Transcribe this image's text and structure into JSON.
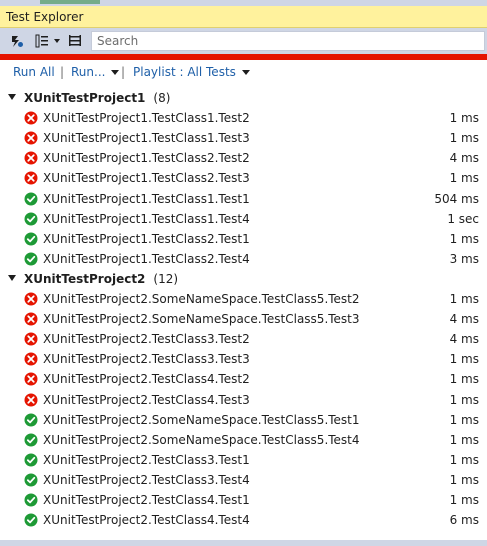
{
  "window": {
    "title": "Test Explorer"
  },
  "search": {
    "placeholder": "Search"
  },
  "actions": {
    "run_all": "Run All",
    "run": "Run...",
    "playlist": "Playlist : All Tests"
  },
  "colors": {
    "fail": "#e51400",
    "pass": "#1e9a36",
    "link": "#1e5fa8",
    "title_bg": "#fff29d"
  },
  "groups": [
    {
      "name": "XUnitTestProject1",
      "count": "(8)",
      "tests": [
        {
          "status": "fail",
          "name": "XUnitTestProject1.TestClass1.Test2",
          "duration": "1 ms"
        },
        {
          "status": "fail",
          "name": "XUnitTestProject1.TestClass1.Test3",
          "duration": "1 ms"
        },
        {
          "status": "fail",
          "name": "XUnitTestProject1.TestClass2.Test2",
          "duration": "4 ms"
        },
        {
          "status": "fail",
          "name": "XUnitTestProject1.TestClass2.Test3",
          "duration": "1 ms"
        },
        {
          "status": "pass",
          "name": "XUnitTestProject1.TestClass1.Test1",
          "duration": "504 ms"
        },
        {
          "status": "pass",
          "name": "XUnitTestProject1.TestClass1.Test4",
          "duration": "1 sec"
        },
        {
          "status": "pass",
          "name": "XUnitTestProject1.TestClass2.Test1",
          "duration": "1 ms"
        },
        {
          "status": "pass",
          "name": "XUnitTestProject1.TestClass2.Test4",
          "duration": "3 ms"
        }
      ]
    },
    {
      "name": "XUnitTestProject2",
      "count": "(12)",
      "tests": [
        {
          "status": "fail",
          "name": "XUnitTestProject2.SomeNameSpace.TestClass5.Test2",
          "duration": "1 ms"
        },
        {
          "status": "fail",
          "name": "XUnitTestProject2.SomeNameSpace.TestClass5.Test3",
          "duration": "4 ms"
        },
        {
          "status": "fail",
          "name": "XUnitTestProject2.TestClass3.Test2",
          "duration": "4 ms"
        },
        {
          "status": "fail",
          "name": "XUnitTestProject2.TestClass3.Test3",
          "duration": "1 ms"
        },
        {
          "status": "fail",
          "name": "XUnitTestProject2.TestClass4.Test2",
          "duration": "1 ms"
        },
        {
          "status": "fail",
          "name": "XUnitTestProject2.TestClass4.Test3",
          "duration": "1 ms"
        },
        {
          "status": "pass",
          "name": "XUnitTestProject2.SomeNameSpace.TestClass5.Test1",
          "duration": "1 ms"
        },
        {
          "status": "pass",
          "name": "XUnitTestProject2.SomeNameSpace.TestClass5.Test4",
          "duration": "1 ms"
        },
        {
          "status": "pass",
          "name": "XUnitTestProject2.TestClass3.Test1",
          "duration": "1 ms"
        },
        {
          "status": "pass",
          "name": "XUnitTestProject2.TestClass3.Test4",
          "duration": "1 ms"
        },
        {
          "status": "pass",
          "name": "XUnitTestProject2.TestClass4.Test1",
          "duration": "1 ms"
        },
        {
          "status": "pass",
          "name": "XUnitTestProject2.TestClass4.Test4",
          "duration": "6 ms"
        }
      ]
    }
  ]
}
